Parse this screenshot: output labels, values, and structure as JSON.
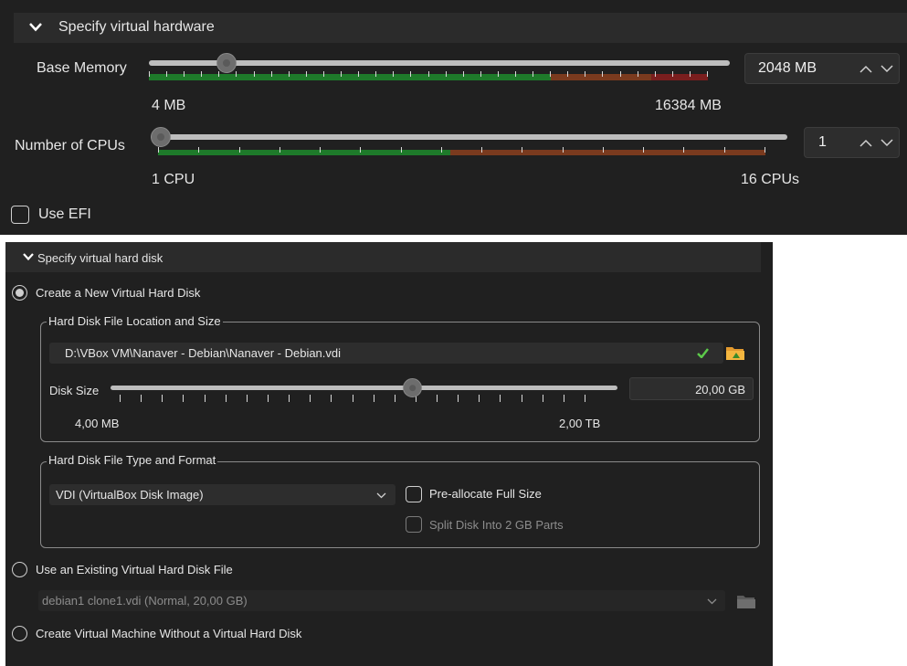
{
  "hardware": {
    "section_title": "Specify virtual hardware",
    "base_memory": {
      "label": "Base Memory",
      "value": "2048 MB",
      "min_label": "4 MB",
      "max_label": "16384 MB",
      "level_fraction": 0.125
    },
    "cpus": {
      "label": "Number of CPUs",
      "value": "1",
      "min_label": "1 CPU",
      "max_label": "16 CPUs",
      "level_fraction": 0.0
    },
    "use_efi": {
      "label": "Use EFI",
      "checked": false
    }
  },
  "hard_disk": {
    "section_title": "Specify virtual hard disk",
    "create_new": {
      "label": "Create a New Virtual Hard Disk",
      "selected": true
    },
    "location_group": {
      "legend": "Hard Disk File Location and Size",
      "path": "D:\\VBox VM\\Nanaver - Debian\\Nanaver - Debian.vdi",
      "disk_size_label": "Disk Size",
      "disk_size_value": "20,00 GB",
      "min_label": "4,00 MB",
      "max_label": "2,00 TB",
      "level_fraction": 0.6
    },
    "type_group": {
      "legend": "Hard Disk File Type and Format",
      "format_selected": "VDI (VirtualBox Disk Image)",
      "preallocate_label": "Pre-allocate Full Size",
      "split_label": "Split Disk Into 2 GB Parts"
    },
    "use_existing": {
      "label": "Use an Existing Virtual Hard Disk File",
      "selected": false,
      "file": "debian1 clone1.vdi (Normal, 20,00 GB)"
    },
    "no_disk": {
      "label": "Create Virtual Machine Without a Virtual Hard Disk",
      "selected": false
    }
  },
  "colors": {
    "panel": "#202020",
    "header": "#2b2b2b",
    "green_zone": "#1e7a2a",
    "orange_zone": "#7a3a1e",
    "red_zone": "#7a1e1e",
    "check_green": "#5cc94a",
    "folder_orange": "#e39a2e"
  },
  "icons": {
    "chevron": "chevron-down-icon",
    "valid": "checkmark-icon",
    "folder": "folder-icon"
  }
}
